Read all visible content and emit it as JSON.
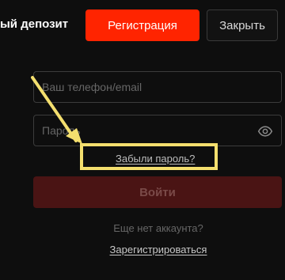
{
  "header": {
    "promo_text": "ый депозит",
    "register_label": "Регистрация",
    "close_label": "Закрыть"
  },
  "form": {
    "login_placeholder": "Ваш телефон/email",
    "password_placeholder": "Пароль",
    "forgot_label": "Забыли пароль?",
    "submit_label": "Войти",
    "no_account_text": "Еще нет аккаунта?",
    "signup_label": "Зарегистрироваться"
  },
  "icons": {
    "password_toggle": "eye-icon",
    "annotation": "arrow-icon"
  },
  "colors": {
    "accent": "#ff2400",
    "highlight": "#f4df6e",
    "background": "#0e0e0e"
  }
}
